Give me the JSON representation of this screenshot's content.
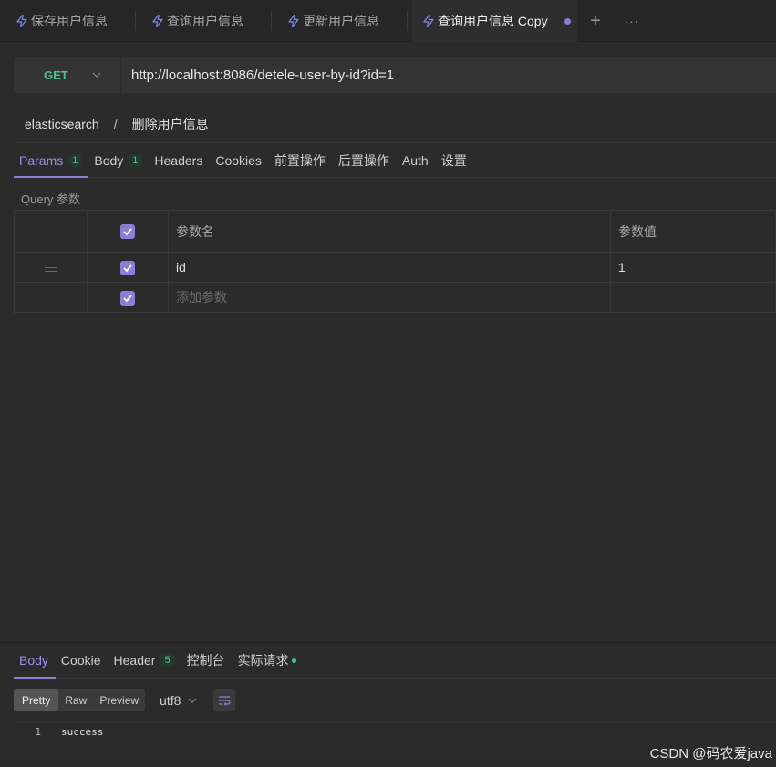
{
  "tabs": [
    {
      "label": "保存用户信息",
      "icon": "bolt-icon"
    },
    {
      "label": "查询用户信息",
      "icon": "bolt-icon"
    },
    {
      "label": "更新用户信息",
      "icon": "bolt-icon"
    },
    {
      "label": "查询用户信息 Copy",
      "icon": "bolt-icon",
      "active": true,
      "unsaved": true
    }
  ],
  "tab_actions": {
    "add": "+",
    "more": "···"
  },
  "request": {
    "method": "GET",
    "url": "http://localhost:8086/detele-user-by-id?id=1"
  },
  "breadcrumb": {
    "folder": "elasticsearch",
    "separator": "/",
    "name": "删除用户信息"
  },
  "request_tabs": [
    {
      "label": "Params",
      "badge": "1",
      "active": true
    },
    {
      "label": "Body",
      "badge": "1"
    },
    {
      "label": "Headers"
    },
    {
      "label": "Cookies"
    },
    {
      "label": "前置操作"
    },
    {
      "label": "后置操作"
    },
    {
      "label": "Auth"
    },
    {
      "label": "设置"
    }
  ],
  "query": {
    "label": "Query 参数",
    "header_name": "参数名",
    "header_value": "参数值",
    "rows": [
      {
        "name": "id",
        "value": "1",
        "checked": true
      }
    ],
    "add_placeholder": "添加参数"
  },
  "response_tabs": [
    {
      "label": "Body",
      "active": true
    },
    {
      "label": "Cookie"
    },
    {
      "label": "Header",
      "badge": "5"
    },
    {
      "label": "控制台"
    },
    {
      "label": "实际请求",
      "dot": true
    }
  ],
  "format": {
    "options": [
      "Pretty",
      "Raw",
      "Preview"
    ],
    "selected": "Pretty",
    "encoding": "utf8"
  },
  "response_body": [
    {
      "line": "1",
      "text": "success"
    }
  ],
  "watermark": "CSDN @码农爱java",
  "colors": {
    "accent": "#8a7fd4",
    "method_get": "#4fc08d",
    "background": "#2b2b2b"
  }
}
